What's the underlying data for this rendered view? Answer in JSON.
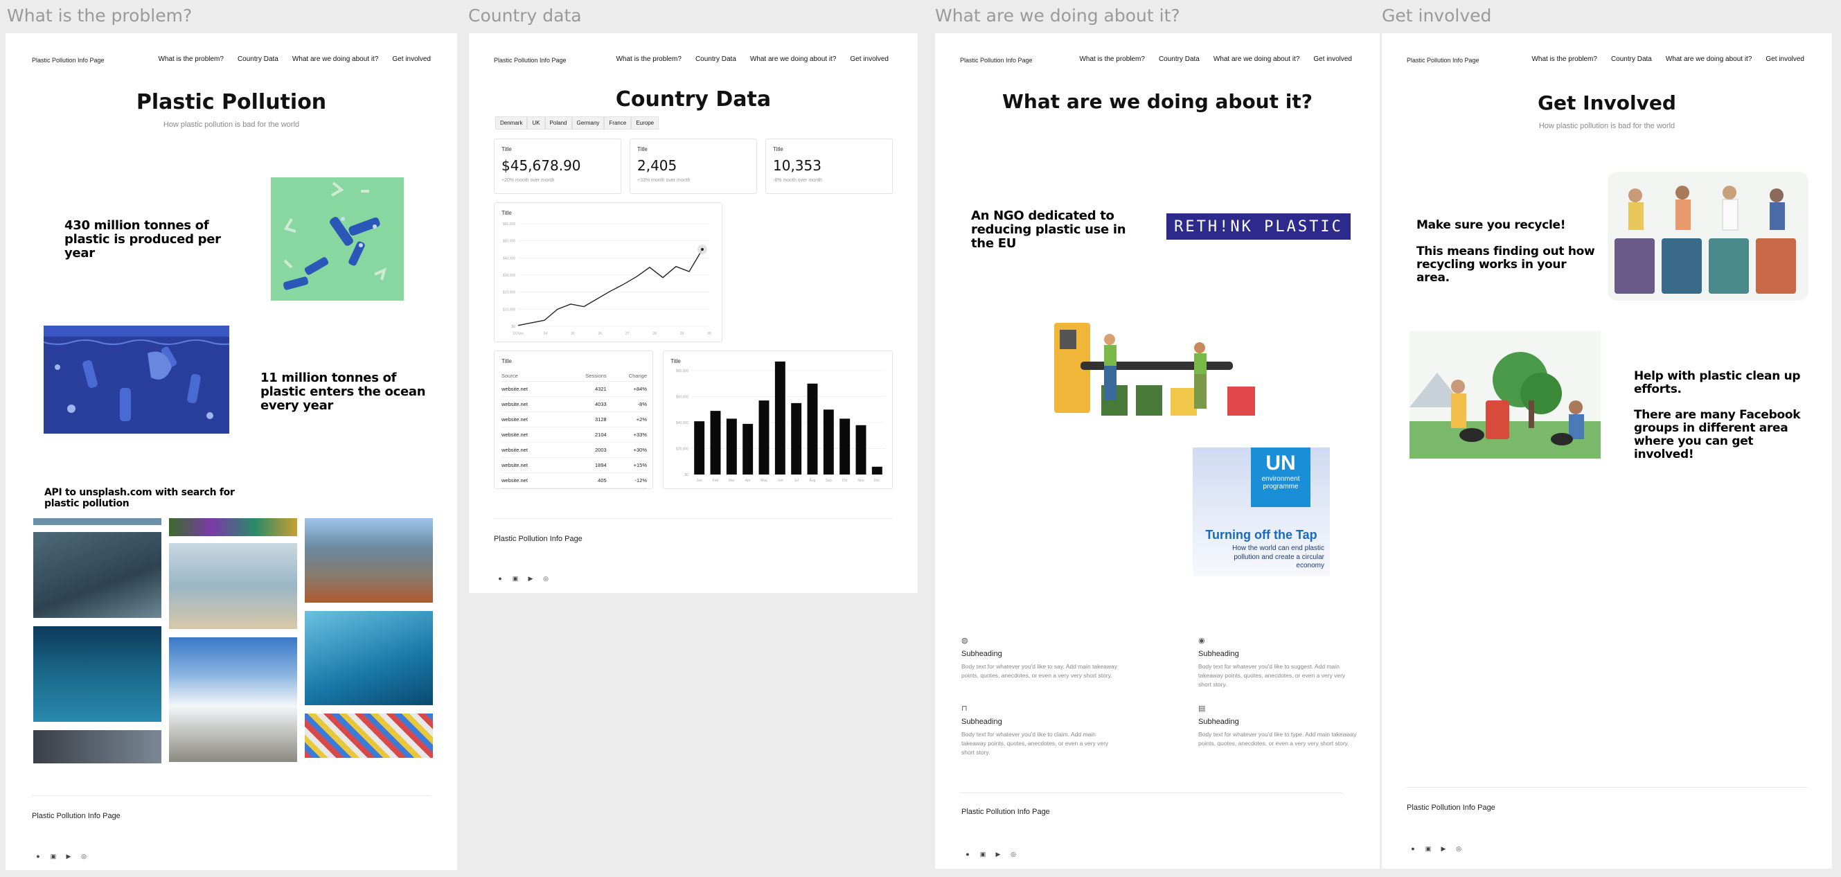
{
  "frame_titles": [
    "What is the problem?",
    "Country data",
    "What are we doing about it?",
    "Get involved"
  ],
  "nav": {
    "brand": "Plastic Pollution Info Page",
    "links": [
      "What is the problem?",
      "Country Data",
      "What are we doing about it?",
      "Get involved"
    ]
  },
  "footer": {
    "brand": "Plastic Pollution Info Page",
    "social_icons": [
      "facebook-icon",
      "linkedin-icon",
      "youtube-icon",
      "instagram-icon"
    ]
  },
  "problem": {
    "title": "Plastic Pollution",
    "subtitle": "How plastic pollution is bad for the world",
    "fact1": "430 million tonnes of plastic is produced per year",
    "fact2": "11 million tonnes of plastic enters the ocean every year",
    "api_note": "API to unsplash.com with search for plastic pollution"
  },
  "country": {
    "title": "Country Data",
    "tabs": [
      "Denmark",
      "UK",
      "Poland",
      "Germany",
      "France",
      "Europe"
    ],
    "stats": [
      {
        "title": "Title",
        "value": "$45,678.90",
        "change": "+20% month over month"
      },
      {
        "title": "Title",
        "value": "2,405",
        "change": "+33% month over month"
      },
      {
        "title": "Title",
        "value": "10,353",
        "change": "-8% month over month"
      }
    ],
    "line_panel_title": "Title",
    "table_panel_title": "Title",
    "bar_panel_title": "Title",
    "table": {
      "headers": [
        "Source",
        "Sessions",
        "Change"
      ],
      "rows": [
        [
          "website.net",
          "4321",
          "+84%"
        ],
        [
          "website.net",
          "4033",
          "-8%"
        ],
        [
          "website.net",
          "3128",
          "+2%"
        ],
        [
          "website.net",
          "2104",
          "+33%"
        ],
        [
          "website.net",
          "2003",
          "+30%"
        ],
        [
          "website.net",
          "1894",
          "+15%"
        ],
        [
          "website.net",
          "405",
          "-12%"
        ]
      ]
    }
  },
  "chart_data": [
    {
      "type": "line",
      "title": "Title",
      "x": [
        "23 Nov",
        "24",
        "25",
        "26",
        "27",
        "28",
        "29",
        "30"
      ],
      "yticks": [
        "$0",
        "$10,000",
        "$20,000",
        "$30,000",
        "$40,000",
        "$50,000",
        "$60,000"
      ],
      "ylim": [
        0,
        60000
      ],
      "values": [
        500,
        2000,
        3500,
        10000,
        13000,
        11500,
        16000,
        20500,
        24500,
        29000,
        34500,
        28500,
        35000,
        32000,
        45000
      ]
    },
    {
      "type": "bar",
      "title": "Title",
      "categories": [
        "Jan",
        "Feb",
        "Mar",
        "Apr",
        "May",
        "Jun",
        "Jul",
        "Aug",
        "Sep",
        "Oct",
        "Nov",
        "Dec"
      ],
      "yticks": [
        "$0",
        "$20,000",
        "$40,000",
        "$60,000",
        "$80,000"
      ],
      "ylim": [
        0,
        80000
      ],
      "values": [
        41000,
        49000,
        43000,
        39000,
        57000,
        87000,
        55000,
        70000,
        50000,
        43000,
        38000,
        6000
      ]
    }
  ],
  "doing": {
    "title": "What are we doing about it?",
    "ngo_text": "An NGO dedicated to reducing plastic use in the EU",
    "rethink_logo": "RETH!NK PLASTIC",
    "un_logo": "UN",
    "un_sub": "environment programme",
    "un_card_title": "Turning off the Tap",
    "un_card_text": "How the world can end plastic pollution and create a circular economy",
    "features": [
      {
        "icon": "globe-icon",
        "heading": "Subheading",
        "body": "Body text for whatever you'd like to say. Add main takeaway points, quotes, anecdotes, or even a very very short story."
      },
      {
        "icon": "user-icon",
        "heading": "Subheading",
        "body": "Body text for whatever you'd like to suggest. Add main takeaway points, quotes, anecdotes, or even a very very short story."
      },
      {
        "icon": "lock-icon",
        "heading": "Subheading",
        "body": "Body text for whatever you'd like to claim. Add main takeaway points, quotes, anecdotes, or even a very very short story."
      },
      {
        "icon": "calendar-icon",
        "heading": "Subheading",
        "body": "Body text for whatever you'd like to type. Add main takeaway points, quotes, anecdotes, or even a very very short story."
      }
    ]
  },
  "involved": {
    "title": "Get Involved",
    "subtitle": "How plastic pollution is bad for the world",
    "recycle1": "Make sure you recycle!",
    "recycle2": "This means finding out how recycling works in your area.",
    "clean1": "Help with plastic clean up efforts.",
    "clean2": "There are many Facebook groups in different area where you can get involved!"
  }
}
